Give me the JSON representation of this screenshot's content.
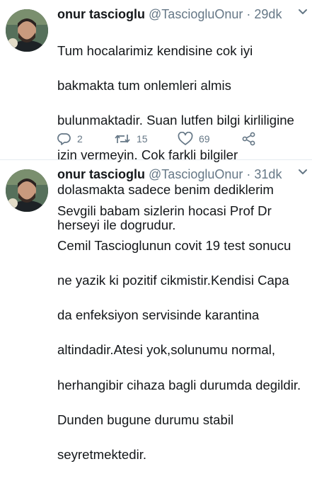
{
  "tweets": [
    {
      "name": "onur tascioglu",
      "handle": "@TasciogluOnur",
      "separator": "·",
      "time": "29dk",
      "lines": [
        "Tum hocalarimiz kendisine cok iyi",
        "bakmakta tum onlemleri almis",
        "bulunmaktadir. Suan lutfen bilgi kirliligine",
        "izin vermeyin. Cok farkli bilgiler",
        "dolasmakta sadece benim dediklerim",
        "herseyi ile dogrudur."
      ],
      "replies": "2",
      "retweets": "15",
      "likes": "69"
    },
    {
      "name": "onur tascioglu",
      "handle": "@TasciogluOnur",
      "separator": "·",
      "time": "31dk",
      "lines": [
        "Sevgili babam sizlerin hocasi Prof Dr",
        "Cemil Tascioglunun covit 19 test sonucu",
        "ne yazik ki pozitif cikmistir.Kendisi Capa",
        "da enfeksiyon servisinde karantina",
        "altindadir.Atesi yok,solunumu normal,",
        "herhangibir cihaza bagli durumda degildir.",
        "Dunden bugune durumu stabil",
        "seyretmektedir."
      ]
    }
  ],
  "colors": {
    "text": "#14171a",
    "muted": "#657786",
    "divider": "#e6ecf0"
  },
  "icons": [
    "reply-icon",
    "retweet-icon",
    "like-icon",
    "share-icon",
    "caret-down-icon"
  ]
}
